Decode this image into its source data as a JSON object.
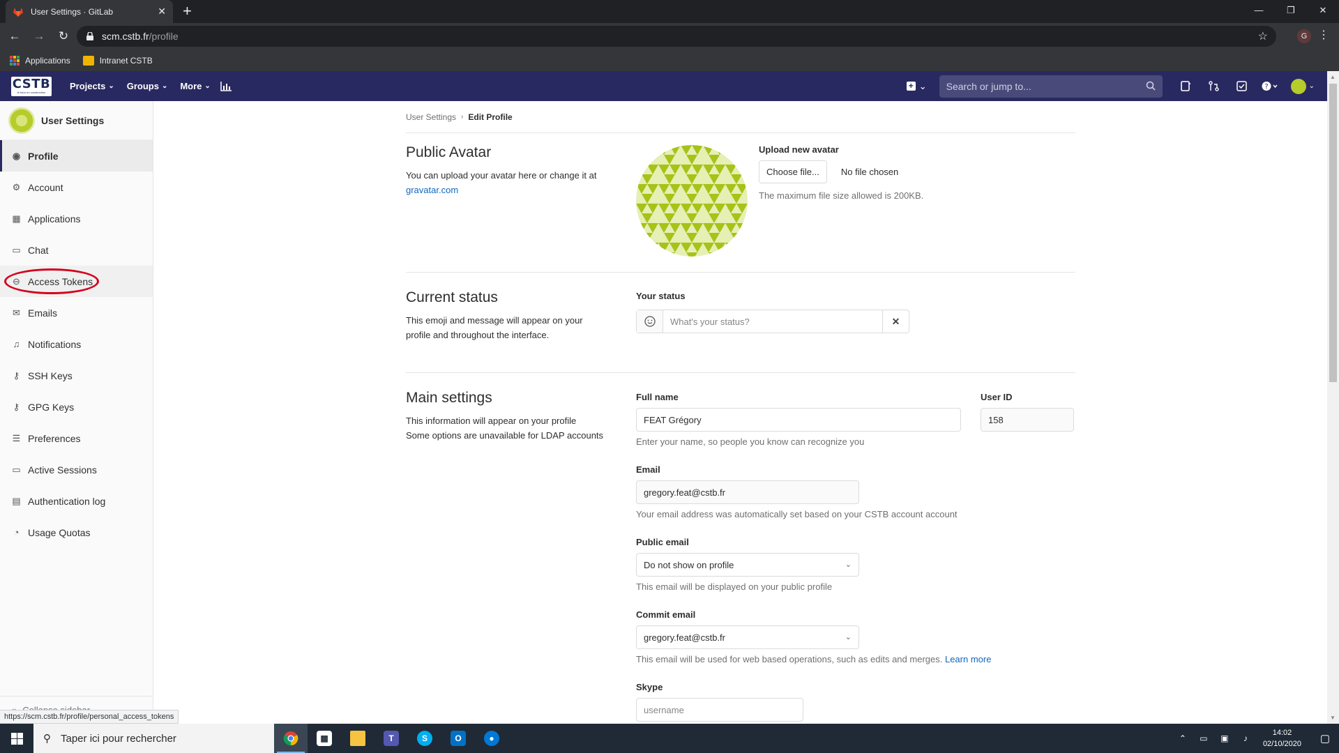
{
  "browser": {
    "tab_title": "User Settings · GitLab",
    "tab_close": "✕",
    "new_tab": "+",
    "url_host": "scm.cstb.fr",
    "url_path": "/profile",
    "profile_letter": "G",
    "bookmarks": [
      "Applications",
      "Intranet CSTB"
    ]
  },
  "gitlab_nav": {
    "logo_text": "CSTB",
    "logo_sub": "le futur en construction",
    "menu": [
      "Projects",
      "Groups",
      "More"
    ],
    "search_placeholder": "Search or jump to..."
  },
  "sidebar": {
    "title": "User Settings",
    "items": [
      {
        "label": "Profile",
        "icon": "user-circle-icon"
      },
      {
        "label": "Account",
        "icon": "account-icon"
      },
      {
        "label": "Applications",
        "icon": "applications-grid-icon"
      },
      {
        "label": "Chat",
        "icon": "comment-icon"
      },
      {
        "label": "Access Tokens",
        "icon": "token-icon"
      },
      {
        "label": "Emails",
        "icon": "envelope-icon"
      },
      {
        "label": "Notifications",
        "icon": "bell-icon"
      },
      {
        "label": "SSH Keys",
        "icon": "key-icon"
      },
      {
        "label": "GPG Keys",
        "icon": "key-icon"
      },
      {
        "label": "Preferences",
        "icon": "preferences-icon"
      },
      {
        "label": "Active Sessions",
        "icon": "monitor-icon"
      },
      {
        "label": "Authentication log",
        "icon": "log-icon"
      },
      {
        "label": "Usage Quotas",
        "icon": "quota-icon"
      }
    ],
    "collapse": "Collapse sidebar"
  },
  "breadcrumb": {
    "parent": "User Settings",
    "current": "Edit Profile"
  },
  "avatar_section": {
    "title": "Public Avatar",
    "desc": "You can upload your avatar here or change it at",
    "link": "gravatar.com",
    "upload_label": "Upload new avatar",
    "choose_btn": "Choose file...",
    "no_file": "No file chosen",
    "max_size": "The maximum file size allowed is 200KB."
  },
  "status_section": {
    "title": "Current status",
    "desc": "This emoji and message will appear on your profile and throughout the interface.",
    "label": "Your status",
    "placeholder": "What's your status?",
    "clear": "✕"
  },
  "main_section": {
    "title": "Main settings",
    "desc_line1": "This information will appear on your profile",
    "desc_line2": "Some options are unavailable for LDAP accounts",
    "full_name_label": "Full name",
    "full_name_value": "FEAT Grégory",
    "full_name_help": "Enter your name, so people you know can recognize you",
    "user_id_label": "User ID",
    "user_id_value": "158",
    "email_label": "Email",
    "email_value": "gregory.feat@cstb.fr",
    "email_help": "Your email address was automatically set based on your CSTB account account",
    "public_email_label": "Public email",
    "public_email_value": "Do not show on profile",
    "public_email_help": "This email will be displayed on your public profile",
    "commit_email_label": "Commit email",
    "commit_email_value": "gregory.feat@cstb.fr",
    "commit_email_help": "This email will be used for web based operations, such as edits and merges.",
    "learn_more": "Learn more",
    "skype_label": "Skype",
    "skype_placeholder": "username"
  },
  "status_url": "https://scm.cstb.fr/profile/personal_access_tokens",
  "taskbar": {
    "search_placeholder": "Taper ici pour rechercher",
    "time": "14:02",
    "date": "02/10/2020"
  }
}
